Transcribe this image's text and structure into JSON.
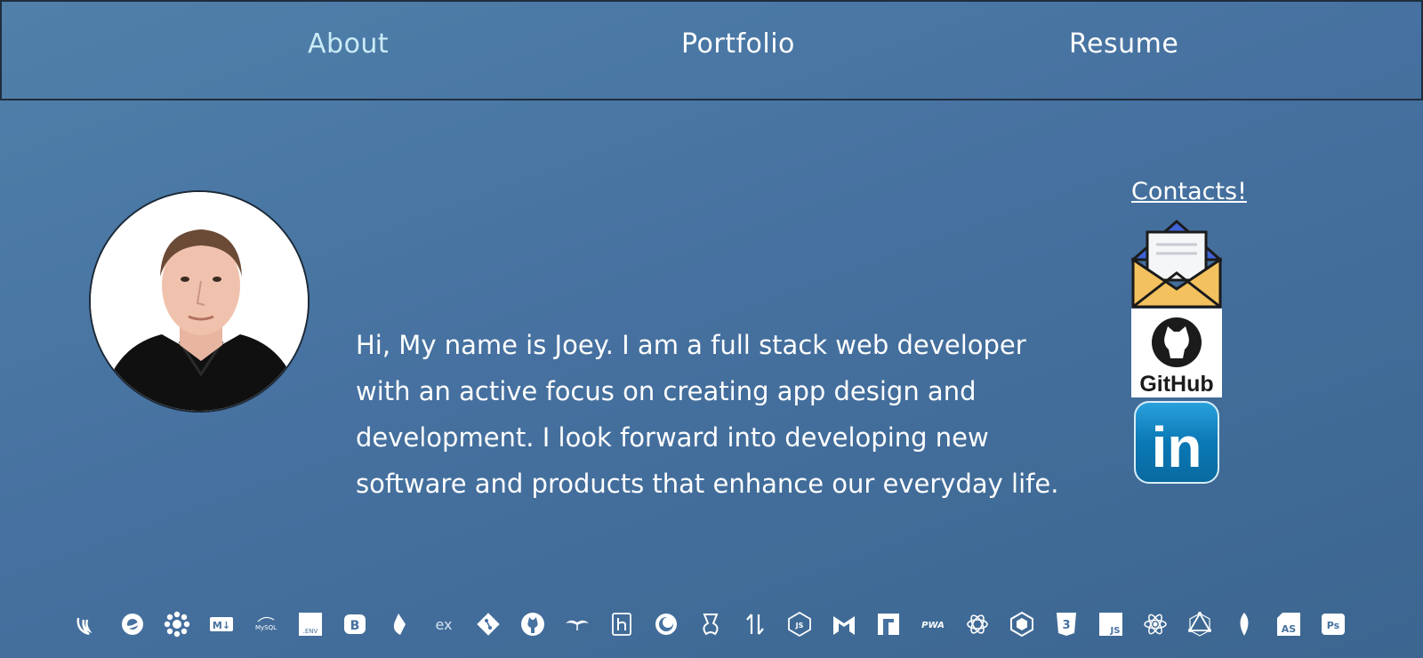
{
  "nav": {
    "about": "About",
    "portfolio": "Portfolio",
    "resume": "Resume"
  },
  "profile": {
    "bio": "Hi, My name is Joey. I am a full stack web developer with an active focus on creating app design and development. I look forward into developing new software and products that enhance our everyday life."
  },
  "contacts": {
    "title": "Contacts!",
    "github_label": "GitHub",
    "linkedin_label": "in"
  },
  "tech_icons": [
    {
      "name": "jquery-icon"
    },
    {
      "name": "openshift-icon"
    },
    {
      "name": "jest-icon"
    },
    {
      "name": "markdown-icon",
      "label": "M↓"
    },
    {
      "name": "mysql-icon",
      "label": "MySQL"
    },
    {
      "name": "dotenv-icon",
      "label": ".ENV"
    },
    {
      "name": "bootstrap-icon",
      "label": "B"
    },
    {
      "name": "handlebars-icon"
    },
    {
      "name": "express-icon",
      "label": "ex"
    },
    {
      "name": "git-icon"
    },
    {
      "name": "github-icon"
    },
    {
      "name": "handlebars-mustache-icon"
    },
    {
      "name": "heroku-icon"
    },
    {
      "name": "insomnia-icon"
    },
    {
      "name": "jest-test-icon"
    },
    {
      "name": "sort-icon"
    },
    {
      "name": "nodejs-icon",
      "label": "JS"
    },
    {
      "name": "materialize-icon"
    },
    {
      "name": "npm-icon",
      "label": "n"
    },
    {
      "name": "pwa-icon",
      "label": "PWA"
    },
    {
      "name": "graphql-icon"
    },
    {
      "name": "webpack-icon"
    },
    {
      "name": "css3-icon",
      "label": "3"
    },
    {
      "name": "javascript-icon",
      "label": "JS"
    },
    {
      "name": "react-icon"
    },
    {
      "name": "apollo-icon"
    },
    {
      "name": "mongodb-icon"
    },
    {
      "name": "adobe-as-icon",
      "label": "AS"
    },
    {
      "name": "photoshop-icon",
      "label": "Ps"
    }
  ],
  "colors": {
    "background_start": "#5080aa",
    "background_end": "#3c6690",
    "nav_active": "#c9ecf7",
    "linkedin_blue": "#0a78b5",
    "email_yellow": "#f3c15e",
    "email_blue": "#3f63d6"
  }
}
